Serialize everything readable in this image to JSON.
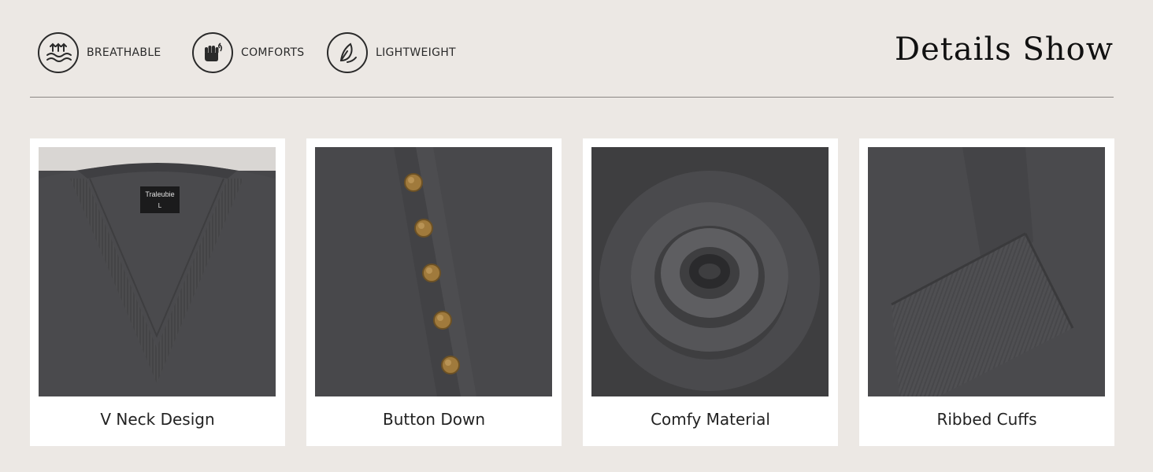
{
  "features": [
    {
      "icon": "breathable-waves-icon",
      "label": "BREATHABLE"
    },
    {
      "icon": "fist-leaf-icon",
      "label": "COMFORTS"
    },
    {
      "icon": "feather-icon",
      "label": "LIGHTWEIGHT"
    }
  ],
  "header": {
    "title": "Details Show"
  },
  "cards": [
    {
      "caption": "V Neck Design",
      "brand_tag": "Traleubie",
      "size_tag": "L"
    },
    {
      "caption": "Button Down"
    },
    {
      "caption": "Comfy Material"
    },
    {
      "caption": "Ribbed Cuffs"
    }
  ],
  "colors": {
    "background": "#ece8e4",
    "fabric": "#4a4a4c",
    "button_brass": "#a07a3c",
    "text": "#222222"
  }
}
